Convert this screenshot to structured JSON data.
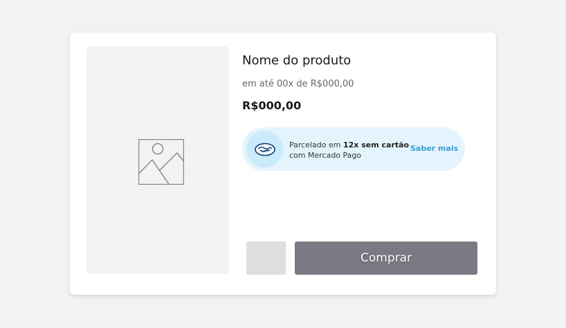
{
  "product": {
    "title": "Nome do produto",
    "installments": "em até 00x de R$000,00",
    "price": "R$000,00",
    "image_icon": "image-placeholder-icon"
  },
  "mercado_pago": {
    "line1_prefix": "Parcelado em ",
    "line1_bold": "12x sem cartão",
    "line2": "com Mercado Pago",
    "link": "Saber mais",
    "logo_icon": "mercado-pago-handshake-icon",
    "banner_color": "#e3f4fd",
    "link_color": "#3a9ed4"
  },
  "actions": {
    "buy_label": "Comprar",
    "buy_color": "#797a83"
  },
  "colors": {
    "background": "#f2f2f2",
    "card": "#ffffff"
  }
}
